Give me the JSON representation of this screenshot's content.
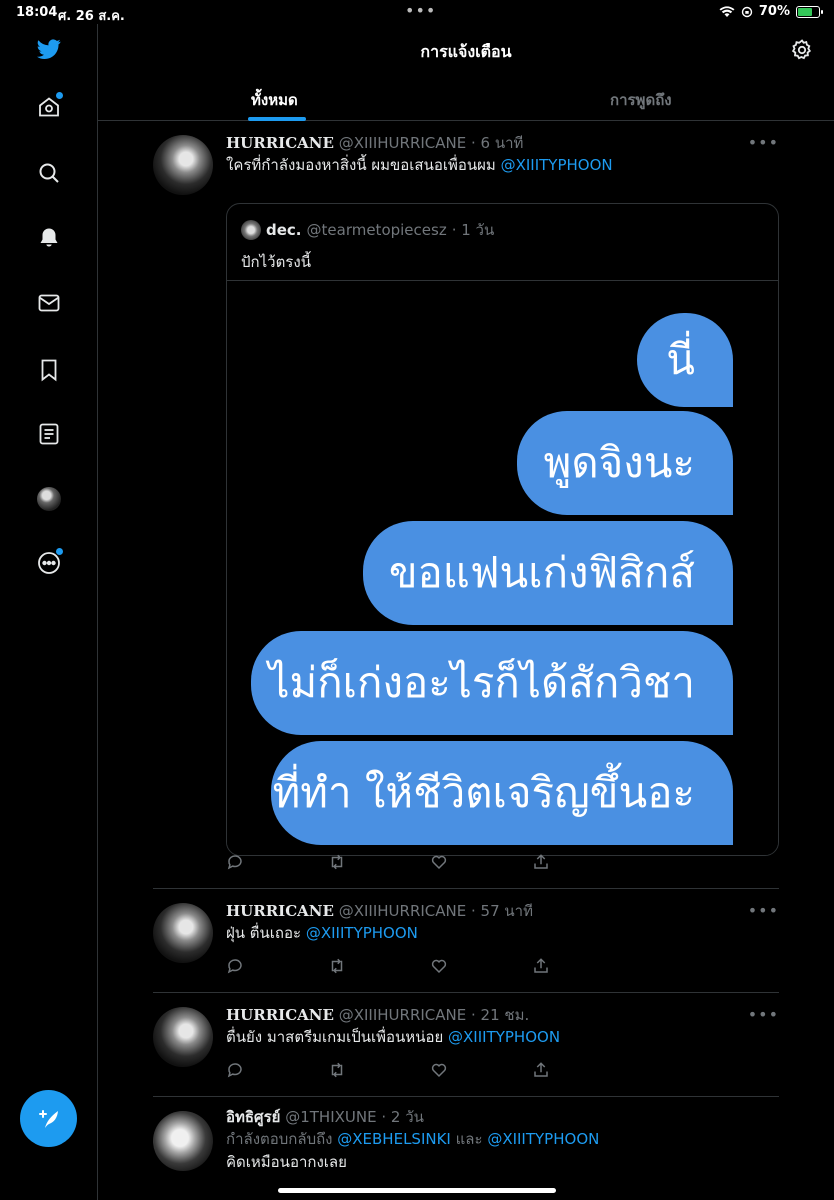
{
  "status_bar": {
    "time": "18:04",
    "date": "ศ. 26 ส.ค.",
    "battery": "70%",
    "battery_level": 0.7,
    "dots": "•••"
  },
  "sidebar": {
    "items": [
      "twitter-logo",
      "home-icon",
      "search-icon",
      "bell-icon",
      "mail-icon",
      "bookmark-icon",
      "lists-icon",
      "profile-avatar",
      "more-icon"
    ]
  },
  "header": {
    "title": "การแจ้งเตือน",
    "tabs": [
      {
        "label": "ทั้งหมด",
        "active": true
      },
      {
        "label": "การพูดถึง",
        "active": false
      }
    ]
  },
  "tweets": [
    {
      "name": "HURRICANE",
      "handle": "@XIIIHURRICANE",
      "time": "· 6 นาที",
      "text": "ใครที่กำลังมองหาสิ่งนี้ ผมขอเสนอเพื่อนผม ",
      "mention": "@XIIITYPHOON",
      "quote": {
        "name": "dec.",
        "handle": "@tearmetopiecesz",
        "time": "· 1 วัน",
        "text": "ปักไว้ตรงนี้",
        "bubbles": [
          "นี่",
          "พูดจิงนะ",
          "ขอแฟนเก่งฟิสิกส์",
          "ไม่ก็เก่งอะไรก็ได้สักวิชา",
          "ที่ทำ ให้ชีวิตเจริญขึ้นอะ"
        ]
      }
    },
    {
      "name": "HURRICANE",
      "handle": "@XIIIHURRICANE",
      "time": "· 57 นาที",
      "text": "ฝุ่น ตื่นเถอะ ",
      "mention": "@XIIITYPHOON"
    },
    {
      "name": "HURRICANE",
      "handle": "@XIIIHURRICANE",
      "time": "· 21 ชม.",
      "text": "ตื่นยัง มาสตรีมเกมเป็นเพื่อนหน่อย ",
      "mention": "@XIIITYPHOON"
    },
    {
      "name": "อิทธิศูรย์",
      "handle": "@1THIXUNE",
      "time": "· 2 วัน",
      "reply_prefix": "กำลังตอบกลับถึง ",
      "reply_mention_1": "@XEBHELSINKI",
      "reply_and": " และ ",
      "reply_mention_2": "@XIIITYPHOON",
      "text": "คิดเหมือนอากงเลย"
    }
  ],
  "more_label": "•••",
  "compose_label": "+",
  "accent": "#1d9bf0",
  "bubble_color": "#4a90e2"
}
